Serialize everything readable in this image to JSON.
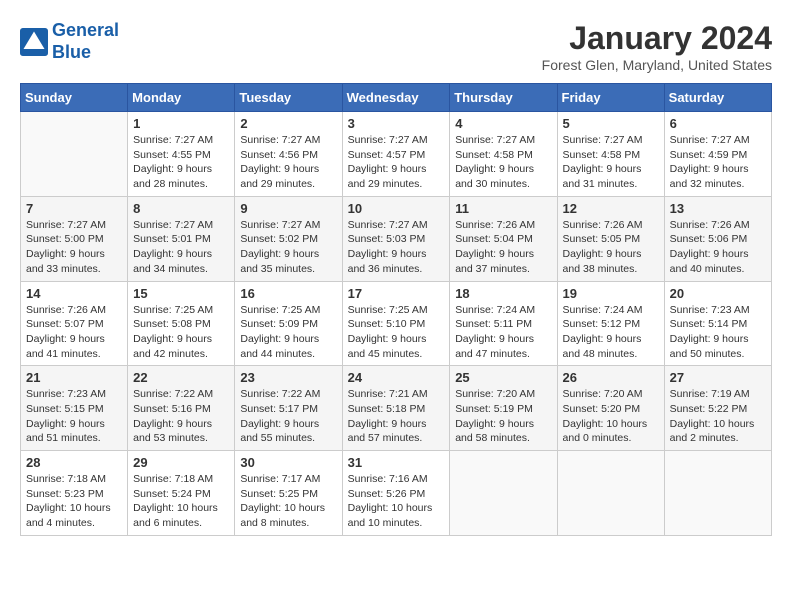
{
  "header": {
    "logo_line1": "General",
    "logo_line2": "Blue",
    "month": "January 2024",
    "location": "Forest Glen, Maryland, United States"
  },
  "weekdays": [
    "Sunday",
    "Monday",
    "Tuesday",
    "Wednesday",
    "Thursday",
    "Friday",
    "Saturday"
  ],
  "weeks": [
    [
      {
        "day": "",
        "info": ""
      },
      {
        "day": "1",
        "info": "Sunrise: 7:27 AM\nSunset: 4:55 PM\nDaylight: 9 hours\nand 28 minutes."
      },
      {
        "day": "2",
        "info": "Sunrise: 7:27 AM\nSunset: 4:56 PM\nDaylight: 9 hours\nand 29 minutes."
      },
      {
        "day": "3",
        "info": "Sunrise: 7:27 AM\nSunset: 4:57 PM\nDaylight: 9 hours\nand 29 minutes."
      },
      {
        "day": "4",
        "info": "Sunrise: 7:27 AM\nSunset: 4:58 PM\nDaylight: 9 hours\nand 30 minutes."
      },
      {
        "day": "5",
        "info": "Sunrise: 7:27 AM\nSunset: 4:58 PM\nDaylight: 9 hours\nand 31 minutes."
      },
      {
        "day": "6",
        "info": "Sunrise: 7:27 AM\nSunset: 4:59 PM\nDaylight: 9 hours\nand 32 minutes."
      }
    ],
    [
      {
        "day": "7",
        "info": "Sunrise: 7:27 AM\nSunset: 5:00 PM\nDaylight: 9 hours\nand 33 minutes."
      },
      {
        "day": "8",
        "info": "Sunrise: 7:27 AM\nSunset: 5:01 PM\nDaylight: 9 hours\nand 34 minutes."
      },
      {
        "day": "9",
        "info": "Sunrise: 7:27 AM\nSunset: 5:02 PM\nDaylight: 9 hours\nand 35 minutes."
      },
      {
        "day": "10",
        "info": "Sunrise: 7:27 AM\nSunset: 5:03 PM\nDaylight: 9 hours\nand 36 minutes."
      },
      {
        "day": "11",
        "info": "Sunrise: 7:26 AM\nSunset: 5:04 PM\nDaylight: 9 hours\nand 37 minutes."
      },
      {
        "day": "12",
        "info": "Sunrise: 7:26 AM\nSunset: 5:05 PM\nDaylight: 9 hours\nand 38 minutes."
      },
      {
        "day": "13",
        "info": "Sunrise: 7:26 AM\nSunset: 5:06 PM\nDaylight: 9 hours\nand 40 minutes."
      }
    ],
    [
      {
        "day": "14",
        "info": "Sunrise: 7:26 AM\nSunset: 5:07 PM\nDaylight: 9 hours\nand 41 minutes."
      },
      {
        "day": "15",
        "info": "Sunrise: 7:25 AM\nSunset: 5:08 PM\nDaylight: 9 hours\nand 42 minutes."
      },
      {
        "day": "16",
        "info": "Sunrise: 7:25 AM\nSunset: 5:09 PM\nDaylight: 9 hours\nand 44 minutes."
      },
      {
        "day": "17",
        "info": "Sunrise: 7:25 AM\nSunset: 5:10 PM\nDaylight: 9 hours\nand 45 minutes."
      },
      {
        "day": "18",
        "info": "Sunrise: 7:24 AM\nSunset: 5:11 PM\nDaylight: 9 hours\nand 47 minutes."
      },
      {
        "day": "19",
        "info": "Sunrise: 7:24 AM\nSunset: 5:12 PM\nDaylight: 9 hours\nand 48 minutes."
      },
      {
        "day": "20",
        "info": "Sunrise: 7:23 AM\nSunset: 5:14 PM\nDaylight: 9 hours\nand 50 minutes."
      }
    ],
    [
      {
        "day": "21",
        "info": "Sunrise: 7:23 AM\nSunset: 5:15 PM\nDaylight: 9 hours\nand 51 minutes."
      },
      {
        "day": "22",
        "info": "Sunrise: 7:22 AM\nSunset: 5:16 PM\nDaylight: 9 hours\nand 53 minutes."
      },
      {
        "day": "23",
        "info": "Sunrise: 7:22 AM\nSunset: 5:17 PM\nDaylight: 9 hours\nand 55 minutes."
      },
      {
        "day": "24",
        "info": "Sunrise: 7:21 AM\nSunset: 5:18 PM\nDaylight: 9 hours\nand 57 minutes."
      },
      {
        "day": "25",
        "info": "Sunrise: 7:20 AM\nSunset: 5:19 PM\nDaylight: 9 hours\nand 58 minutes."
      },
      {
        "day": "26",
        "info": "Sunrise: 7:20 AM\nSunset: 5:20 PM\nDaylight: 10 hours\nand 0 minutes."
      },
      {
        "day": "27",
        "info": "Sunrise: 7:19 AM\nSunset: 5:22 PM\nDaylight: 10 hours\nand 2 minutes."
      }
    ],
    [
      {
        "day": "28",
        "info": "Sunrise: 7:18 AM\nSunset: 5:23 PM\nDaylight: 10 hours\nand 4 minutes."
      },
      {
        "day": "29",
        "info": "Sunrise: 7:18 AM\nSunset: 5:24 PM\nDaylight: 10 hours\nand 6 minutes."
      },
      {
        "day": "30",
        "info": "Sunrise: 7:17 AM\nSunset: 5:25 PM\nDaylight: 10 hours\nand 8 minutes."
      },
      {
        "day": "31",
        "info": "Sunrise: 7:16 AM\nSunset: 5:26 PM\nDaylight: 10 hours\nand 10 minutes."
      },
      {
        "day": "",
        "info": ""
      },
      {
        "day": "",
        "info": ""
      },
      {
        "day": "",
        "info": ""
      }
    ]
  ]
}
